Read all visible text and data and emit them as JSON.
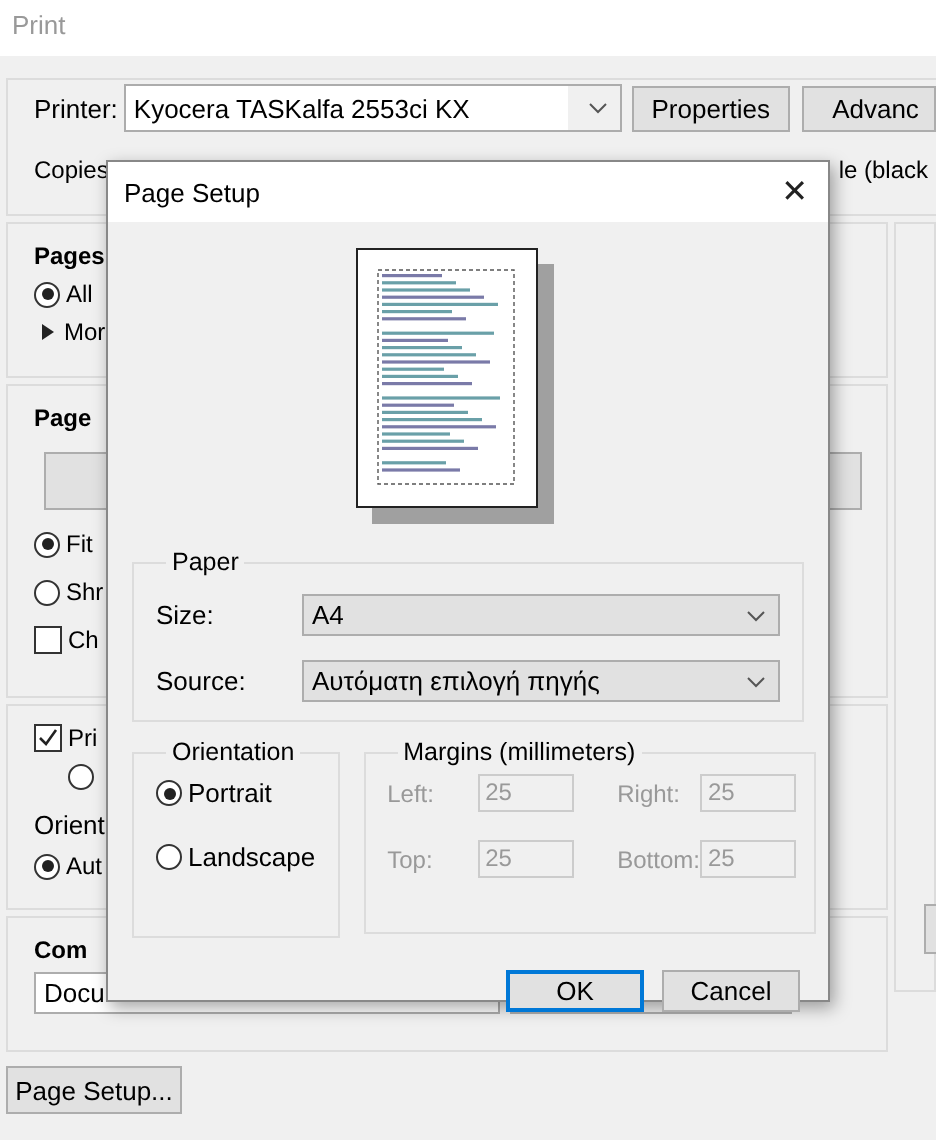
{
  "window": {
    "title": "Print"
  },
  "printer": {
    "label": "Printer:",
    "value": "Kyocera TASKalfa 2553ci KX",
    "buttons": [
      "Properties",
      "Advanc"
    ]
  },
  "copies": {
    "label": "Copies"
  },
  "color_option": {
    "text": "le (black"
  },
  "pages": {
    "heading": "Pages",
    "options": [
      {
        "label": "All",
        "selected": true
      }
    ],
    "more": "Mor"
  },
  "page_sizing": {
    "heading": "Page",
    "options": [
      {
        "label": "Fit",
        "selected": true
      },
      {
        "label": "Shr",
        "selected": false
      }
    ],
    "choose": {
      "label": "Ch",
      "checked": false
    }
  },
  "print_section": {
    "checkbox": {
      "label": "Pri",
      "checked": true
    },
    "sub_option": {
      "selected": false
    },
    "orientation_label": "Orient",
    "orientation_option": {
      "label": "Aut",
      "selected": true
    }
  },
  "comments": {
    "heading": "Com",
    "field_value": "Docu"
  },
  "page_setup_button": "Page Setup...",
  "dialog": {
    "title": "Page Setup",
    "close": "✕",
    "paper": {
      "legend": "Paper",
      "size_label": "Size:",
      "size_value": "A4",
      "source_label": "Source:",
      "source_value": "Αυτόματη επιλογή πηγής"
    },
    "orientation": {
      "legend": "Orientation",
      "options": [
        {
          "label": "Portrait",
          "selected": true
        },
        {
          "label": "Landscape",
          "selected": false
        }
      ]
    },
    "margins": {
      "legend": "Margins (millimeters)",
      "disabled": true,
      "fields": [
        {
          "label": "Left:",
          "value": "25"
        },
        {
          "label": "Right:",
          "value": "25"
        },
        {
          "label": "Top:",
          "value": "25"
        },
        {
          "label": "Bottom:",
          "value": "25"
        }
      ]
    },
    "buttons": [
      {
        "label": "OK",
        "default": true
      },
      {
        "label": "Cancel",
        "default": false
      }
    ]
  }
}
